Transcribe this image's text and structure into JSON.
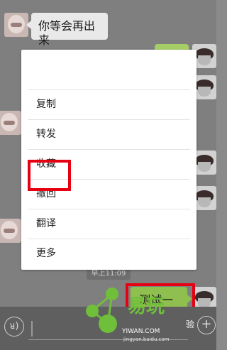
{
  "chat": {
    "messages": [
      {
        "side": "left",
        "text": "你等会再出来"
      },
      {
        "side": "right",
        "text": "测试一下"
      }
    ],
    "timestamp": "早上11:09"
  },
  "context_menu": {
    "items": [
      "复制",
      "转发",
      "收藏",
      "撤回",
      "翻译",
      "更多"
    ],
    "highlighted_item": "撤回"
  },
  "input_bar": {
    "voice_icon": "voice-icon",
    "add_icon": "plus-icon"
  },
  "watermark": {
    "brand": "易玩",
    "brand_suffix": "验",
    "domain": "YIWAN.COM",
    "url": "jingyan.baidu.com"
  },
  "colors": {
    "bubble_green": "#a6ce66",
    "highlight_red": "#e60012",
    "watermark_green": "#6fbf3a"
  }
}
